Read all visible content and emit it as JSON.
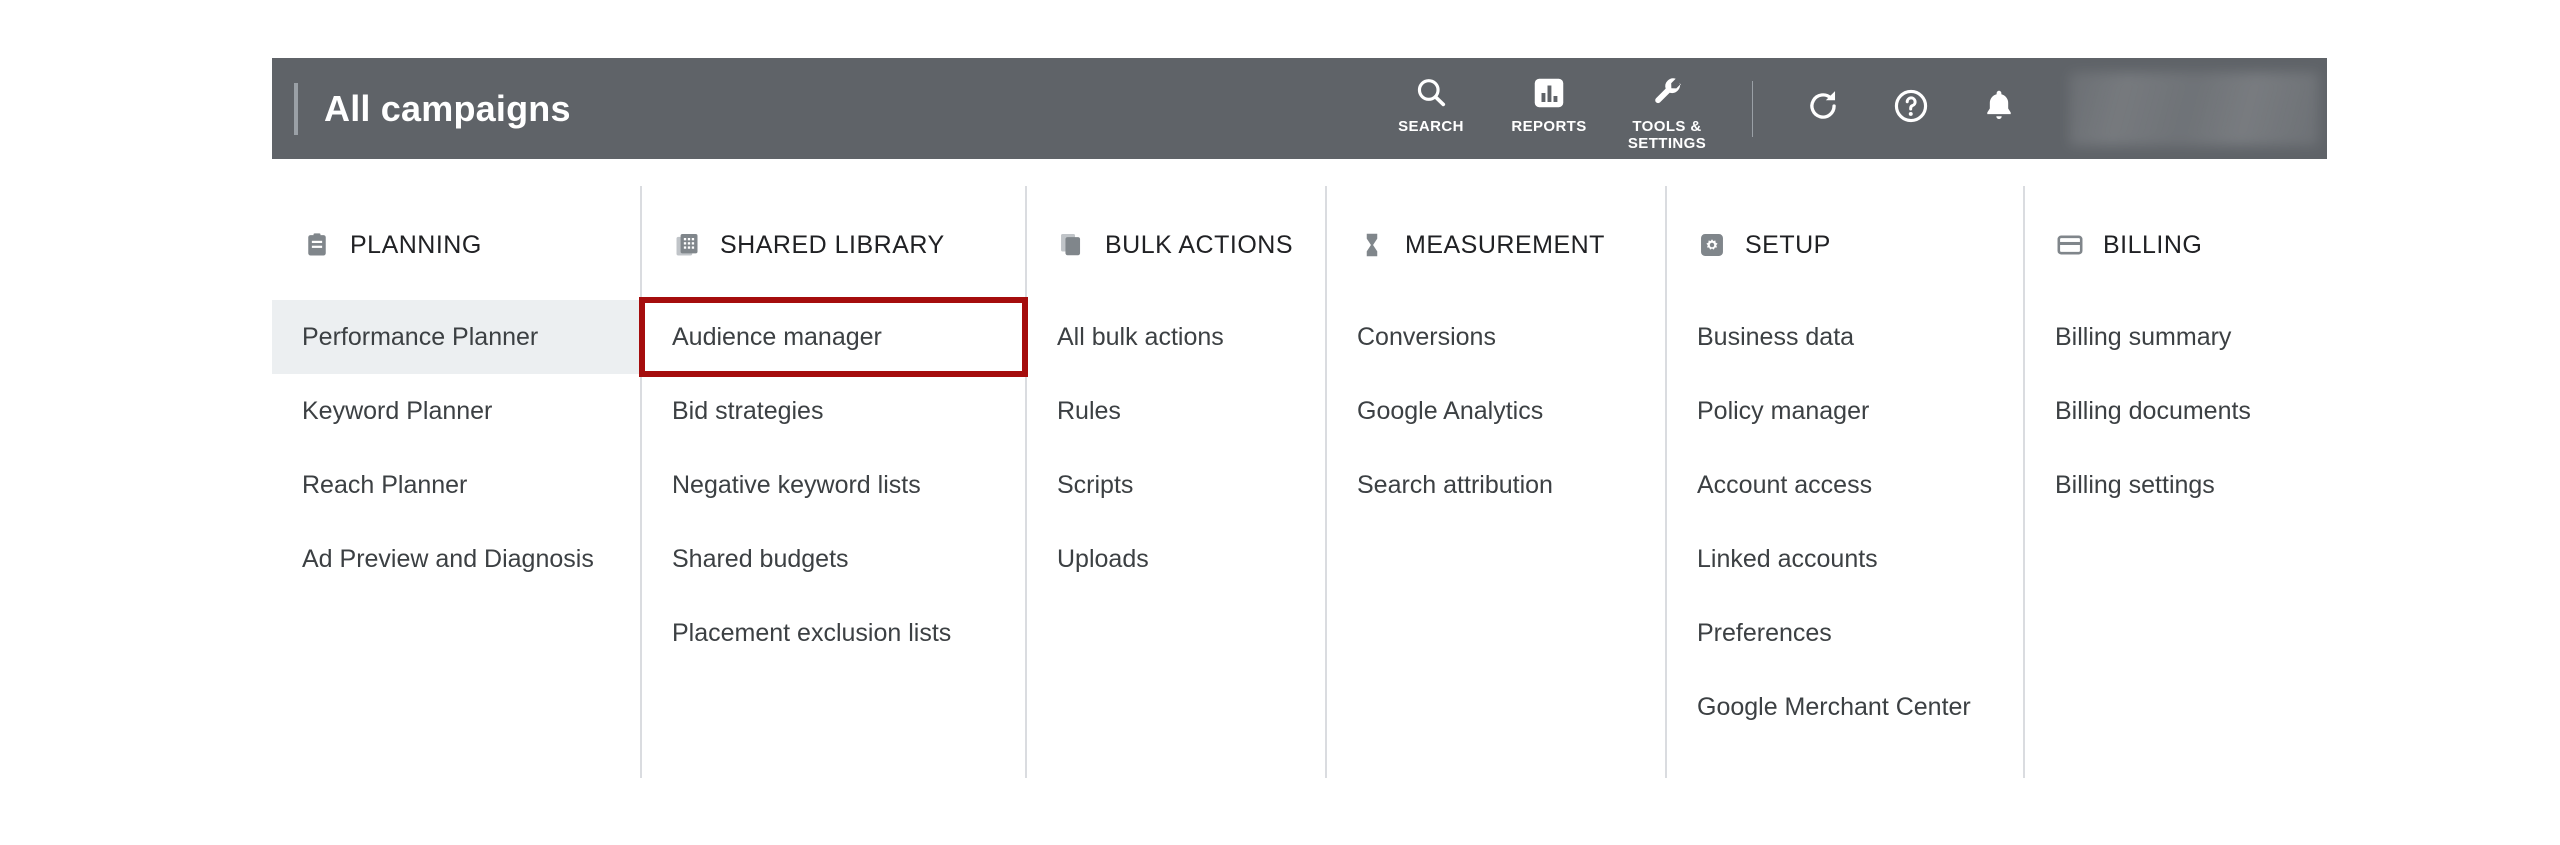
{
  "appbar": {
    "title": "All campaigns",
    "tools": [
      {
        "label": "SEARCH",
        "icon": "search-icon"
      },
      {
        "label": "REPORTS",
        "icon": "reports-bar-chart-icon"
      },
      {
        "label": "TOOLS &\nSETTINGS",
        "icon": "wrench-icon"
      }
    ],
    "actions": [
      {
        "name": "refresh-icon"
      },
      {
        "name": "help-icon"
      },
      {
        "name": "notifications-bell-icon"
      }
    ],
    "account_redacted": true,
    "background_color": "#5f6368",
    "text_color": "#ffffff"
  },
  "menu": {
    "highlight_color": "#a50d0d",
    "hover_color": "#eceff1",
    "columns": [
      {
        "header": "PLANNING",
        "icon": "clipboard-icon",
        "items": [
          {
            "label": "Performance Planner",
            "state": "hovered"
          },
          {
            "label": "Keyword Planner",
            "state": "normal"
          },
          {
            "label": "Reach Planner",
            "state": "normal"
          },
          {
            "label": "Ad Preview and Diagnosis",
            "state": "normal"
          }
        ]
      },
      {
        "header": "SHARED LIBRARY",
        "icon": "library-grid-icon",
        "items": [
          {
            "label": "Audience manager",
            "state": "boxed"
          },
          {
            "label": "Bid strategies",
            "state": "normal"
          },
          {
            "label": "Negative keyword lists",
            "state": "normal"
          },
          {
            "label": "Shared budgets",
            "state": "normal"
          },
          {
            "label": "Placement exclusion lists",
            "state": "normal"
          }
        ]
      },
      {
        "header": "BULK ACTIONS",
        "icon": "stacked-pages-icon",
        "items": [
          {
            "label": "All bulk actions",
            "state": "normal"
          },
          {
            "label": "Rules",
            "state": "normal"
          },
          {
            "label": "Scripts",
            "state": "normal"
          },
          {
            "label": "Uploads",
            "state": "normal"
          }
        ]
      },
      {
        "header": "MEASUREMENT",
        "icon": "hourglass-icon",
        "items": [
          {
            "label": "Conversions",
            "state": "normal"
          },
          {
            "label": "Google Analytics",
            "state": "normal"
          },
          {
            "label": "Search attribution",
            "state": "normal"
          }
        ]
      },
      {
        "header": "SETUP",
        "icon": "gear-icon",
        "items": [
          {
            "label": "Business data",
            "state": "normal"
          },
          {
            "label": "Policy manager",
            "state": "normal"
          },
          {
            "label": "Account access",
            "state": "normal"
          },
          {
            "label": "Linked accounts",
            "state": "normal"
          },
          {
            "label": "Preferences",
            "state": "normal"
          },
          {
            "label": "Google Merchant Center",
            "state": "normal"
          }
        ]
      },
      {
        "header": "BILLING",
        "icon": "credit-card-icon",
        "items": [
          {
            "label": "Billing summary",
            "state": "normal"
          },
          {
            "label": "Billing documents",
            "state": "normal"
          },
          {
            "label": "Billing settings",
            "state": "normal"
          }
        ]
      }
    ]
  }
}
